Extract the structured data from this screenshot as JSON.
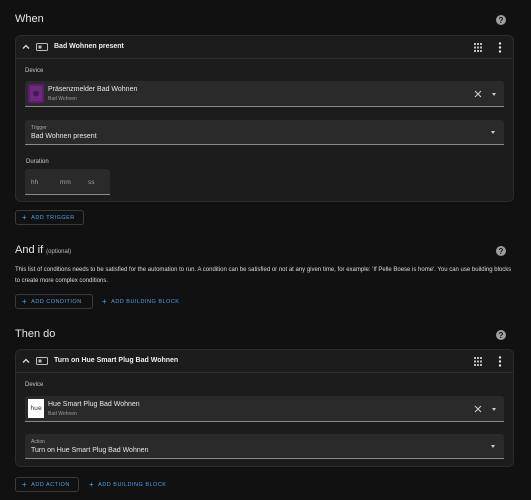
{
  "when": {
    "title": "When",
    "card": {
      "title": "Bad Wohnen present",
      "device_label": "Device",
      "device_name": "Präsenzmelder Bad Wohnen",
      "device_area": "Bad Wohnen",
      "trigger_label": "Trigger",
      "trigger_value": "Bad Wohnen present",
      "duration_label": "Duration",
      "duration_placeholders": {
        "hh": "hh",
        "mm": "mm",
        "ss": "ss"
      }
    },
    "add_trigger": "ADD TRIGGER"
  },
  "and_if": {
    "title": "And if",
    "optional": "(optional)",
    "description": "This list of conditions needs to be satisfied for the automation to run. A condition can be satisfied or not at any given time, for example: 'If Pelle Boese is home'. You can use building blocks to create more complex conditions.",
    "add_condition": "ADD CONDITION",
    "add_building_block": "ADD BUILDING BLOCK"
  },
  "then_do": {
    "title": "Then do",
    "card": {
      "title": "Turn on Hue Smart Plug Bad Wohnen",
      "device_label": "Device",
      "device_name": "Hue Smart Plug Bad Wohnen",
      "device_area": "Bad Wohnen",
      "device_logo_text": "hue",
      "action_label": "Action",
      "action_value": "Turn on Hue Smart Plug Bad Wohnen"
    },
    "add_action": "ADD ACTION",
    "add_building_block": "ADD BUILDING BLOCK"
  },
  "colors": {
    "background": "#111111",
    "card": "#1c1c1c",
    "field": "#2a2a2a",
    "accent": "#4ea0e6",
    "device_icon": "#5a1e6a"
  },
  "icons": [
    "chevron-up-icon",
    "device-icon",
    "drag-handle-icon",
    "more-vertical-icon",
    "help-icon",
    "clear-icon",
    "dropdown-caret-icon",
    "plus-icon",
    "motion-sensor-icon",
    "hue-logo-icon"
  ]
}
